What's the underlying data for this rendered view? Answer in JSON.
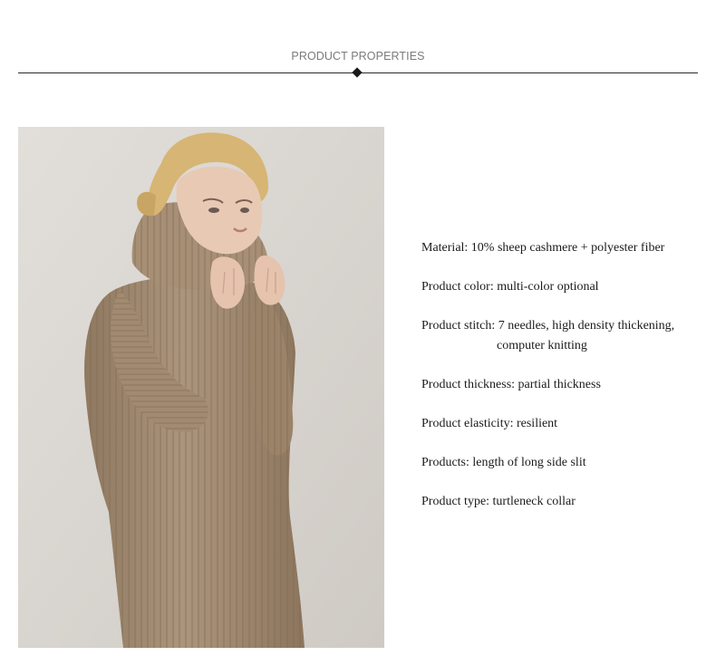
{
  "header": {
    "title": "PRODUCT PROPERTIES"
  },
  "properties": [
    {
      "text": "Material: 10% sheep cashmere + polyester fiber"
    },
    {
      "text": "Product color: multi-color optional"
    },
    {
      "text": "Product stitch: 7 needles, high density thickening,",
      "continuation": "computer knitting"
    },
    {
      "text": "Product thickness: partial thickness"
    },
    {
      "text": "Product elasticity: resilient"
    },
    {
      "text": "Products: length of long side slit"
    },
    {
      "text": "Product type: turtleneck collar"
    }
  ],
  "colors": {
    "title_text": "#7a7a7a",
    "divider": "#2a2a2a",
    "body_text": "#1a1a1a",
    "photo_background": "#d9d5d0",
    "dress": "#a68f76",
    "hair": "#d9b77a",
    "skin": "#e7c7b2"
  }
}
